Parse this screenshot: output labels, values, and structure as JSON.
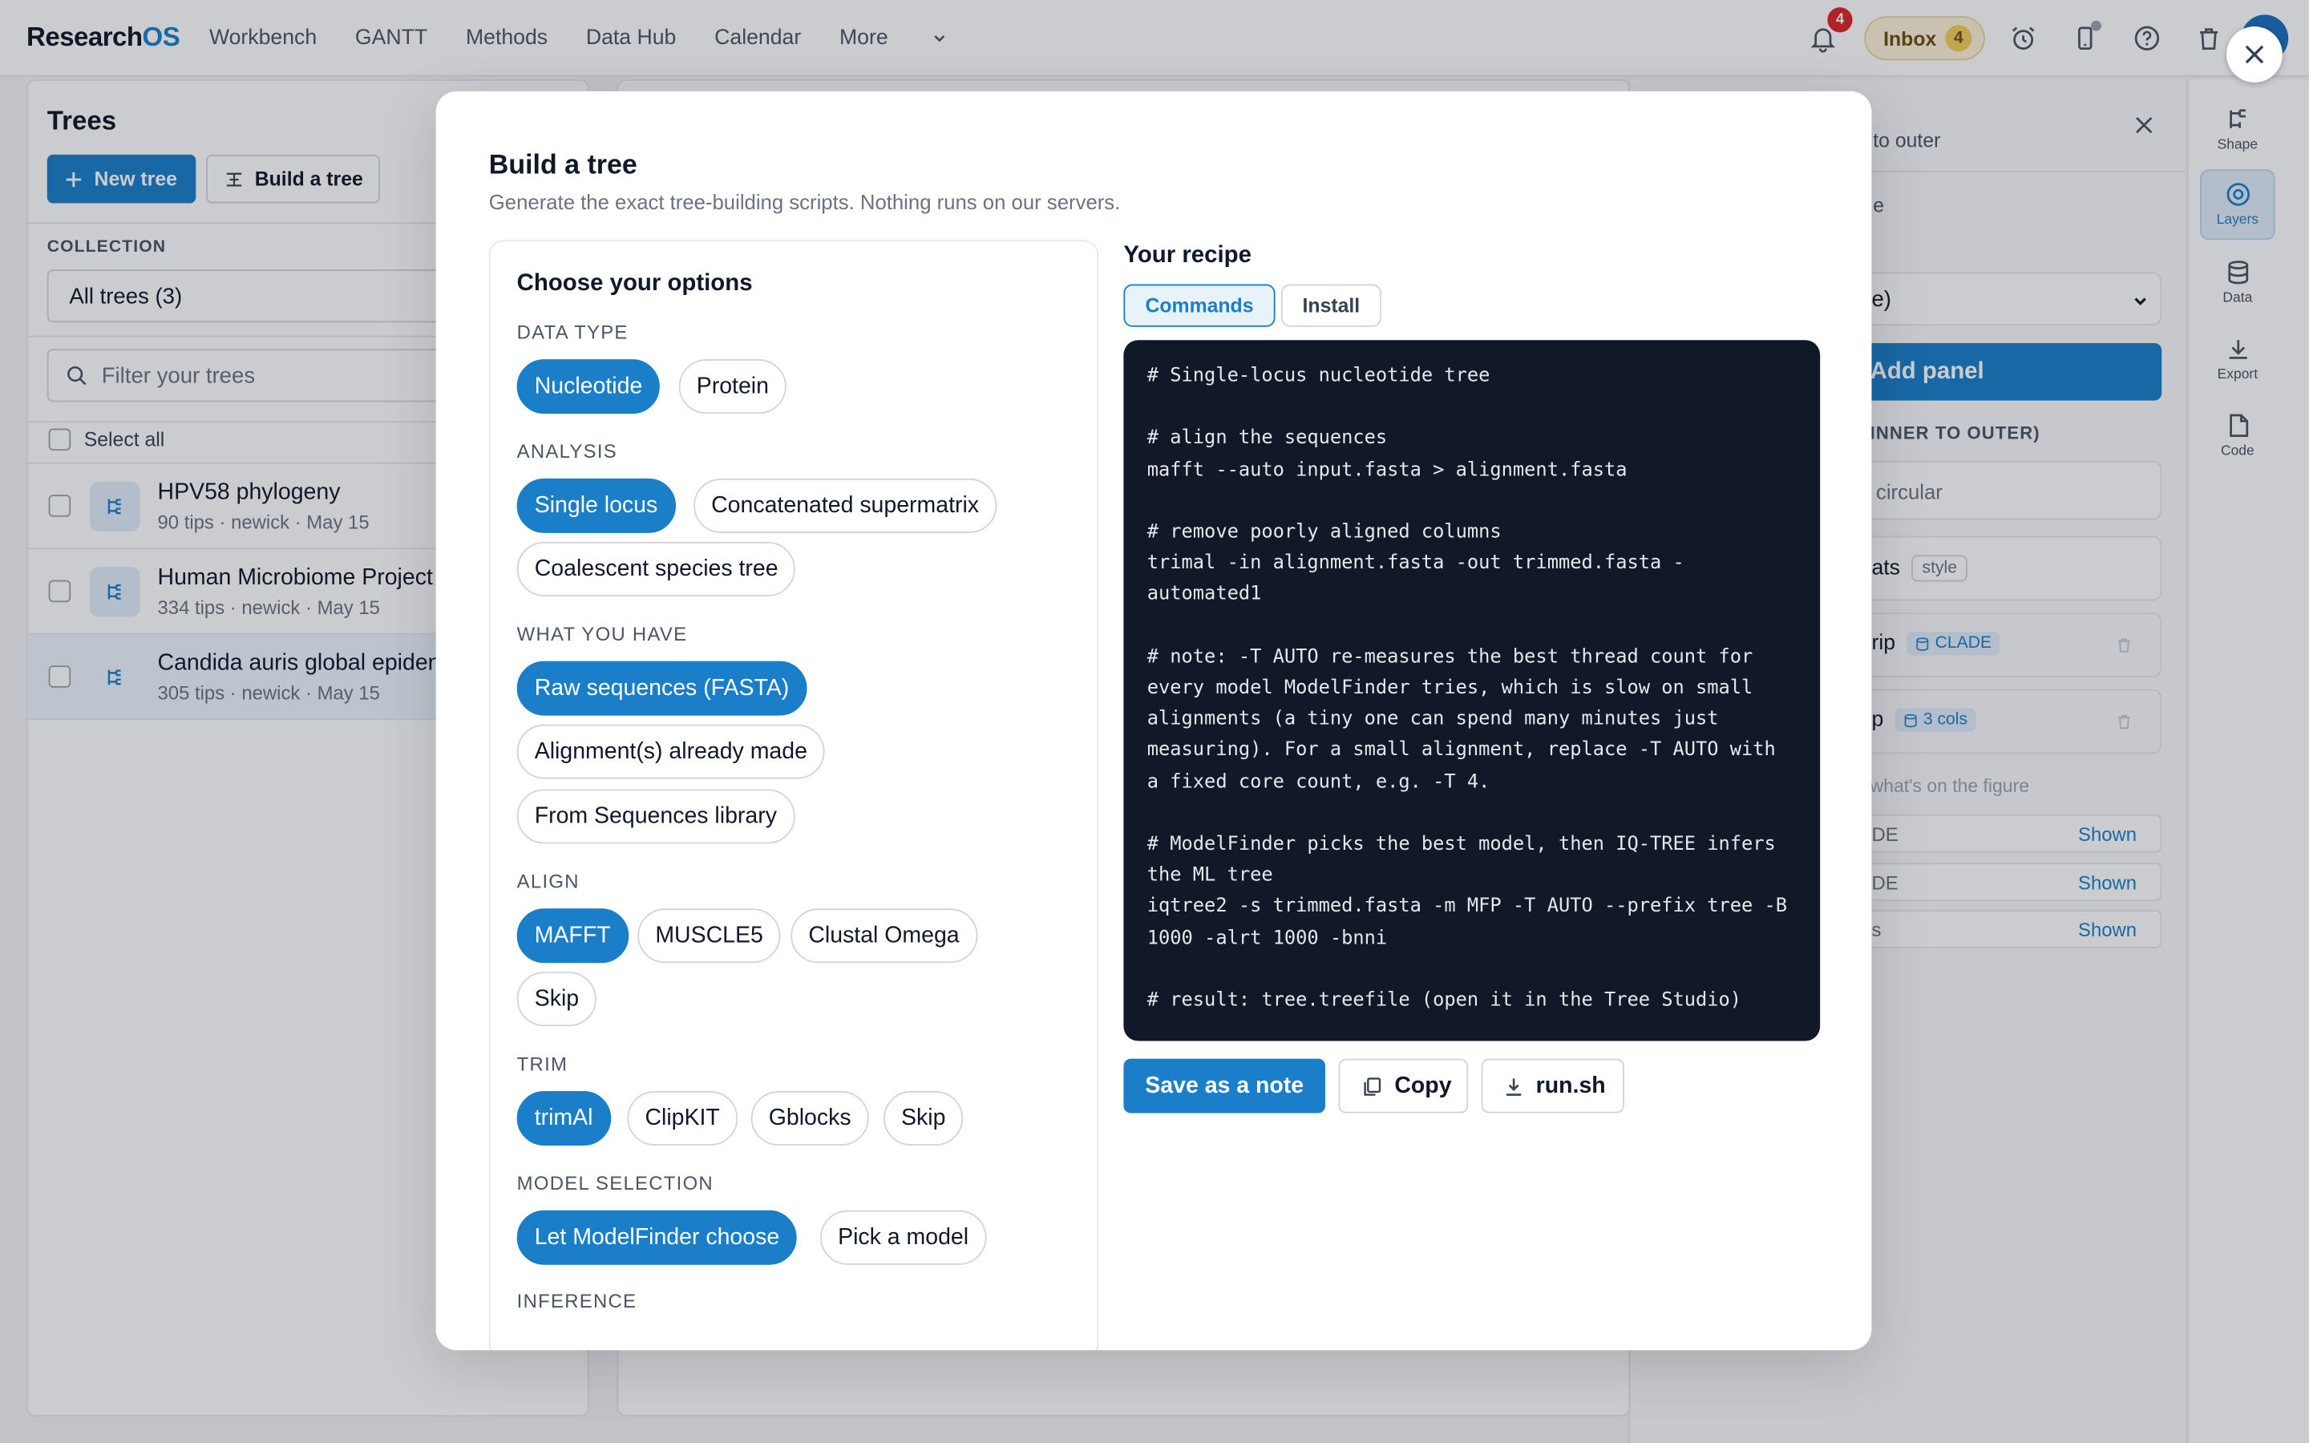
{
  "app": {
    "logo_main": "Research",
    "logo_accent": "OS",
    "nav": [
      "Workbench",
      "GANTT",
      "Methods",
      "Data Hub",
      "Calendar",
      "More"
    ],
    "notifications_count": "4",
    "inbox_label": "Inbox",
    "inbox_count": "4"
  },
  "trees_panel": {
    "title": "Trees",
    "new_tree": "New tree",
    "build_tree": "Build a tree",
    "collection_label": "COLLECTION",
    "collection_value": "All trees (3)",
    "filter_placeholder": "Filter your trees",
    "select_all": "Select all",
    "items": [
      {
        "name": "HPV58 phylogeny",
        "meta": "90 tips · newick · May 15"
      },
      {
        "name": "Human Microbiome Project",
        "meta": "334 tips · newick · May 15"
      },
      {
        "name": "Candida auris global epiden",
        "meta": "305 tips · newick · May 15"
      }
    ]
  },
  "right_panel": {
    "to_outer": "to outer",
    "e_text": "e",
    "select_value": "e)",
    "add_panel": "Add panel",
    "inner_outer": "INNER TO OUTER)",
    "circular": "circular",
    "ats": "ats",
    "style_tag": "style",
    "rip": "rip",
    "clade_tag": "CLADE",
    "p_text": "p",
    "cols_tag": "3 cols",
    "whats_on": "what's on the figure",
    "shown_rows": [
      {
        "label": "DE",
        "status": "Shown"
      },
      {
        "label": "DE",
        "status": "Shown"
      },
      {
        "label": "s",
        "status": "Shown"
      }
    ]
  },
  "rail": [
    "Shape",
    "Layers",
    "Data",
    "Export",
    "Code"
  ],
  "modal": {
    "title": "Build a tree",
    "subtitle": "Generate the exact tree-building scripts. Nothing runs on our servers.",
    "options_title": "Choose your options",
    "sections": {
      "data_type": {
        "label": "DATA TYPE",
        "options": [
          "Nucleotide",
          "Protein"
        ]
      },
      "analysis": {
        "label": "ANALYSIS",
        "options": [
          "Single locus",
          "Concatenated supermatrix",
          "Coalescent species tree"
        ]
      },
      "have": {
        "label": "WHAT YOU HAVE",
        "options": [
          "Raw sequences (FASTA)",
          "Alignment(s) already made",
          "From Sequences library"
        ]
      },
      "align": {
        "label": "ALIGN",
        "options": [
          "MAFFT",
          "MUSCLE5",
          "Clustal Omega",
          "Skip"
        ]
      },
      "trim": {
        "label": "TRIM",
        "options": [
          "trimAl",
          "ClipKIT",
          "Gblocks",
          "Skip"
        ]
      },
      "model": {
        "label": "MODEL SELECTION",
        "options": [
          "Let ModelFinder choose",
          "Pick a model"
        ]
      },
      "inference": {
        "label": "INFERENCE"
      }
    },
    "recipe_title": "Your recipe",
    "tabs": [
      "Commands",
      "Install"
    ],
    "code": "# Single-locus nucleotide tree\n\n# align the sequences\nmafft --auto input.fasta > alignment.fasta\n\n# remove poorly aligned columns\ntrimal -in alignment.fasta -out trimmed.fasta -\nautomated1\n\n# note: -T AUTO re-measures the best thread count for\nevery model ModelFinder tries, which is slow on small\nalignments (a tiny one can spend many minutes just\nmeasuring). For a small alignment, replace -T AUTO with\na fixed core count, e.g. -T 4.\n\n# ModelFinder picks the best model, then IQ-TREE infers\nthe ML tree\niqtree2 -s trimmed.fasta -m MFP -T AUTO --prefix tree -B\n1000 -alrt 1000 -bnni\n\n# result: tree.treefile (open it in the Tree Studio)",
    "actions": {
      "save": "Save as a note",
      "copy": "Copy",
      "run": "run.sh"
    }
  },
  "colors": {
    "accent": "#1a7fc8",
    "code_bg": "#111827",
    "badge_red": "#dc2626",
    "inbox_bg": "#fdf3d8"
  }
}
